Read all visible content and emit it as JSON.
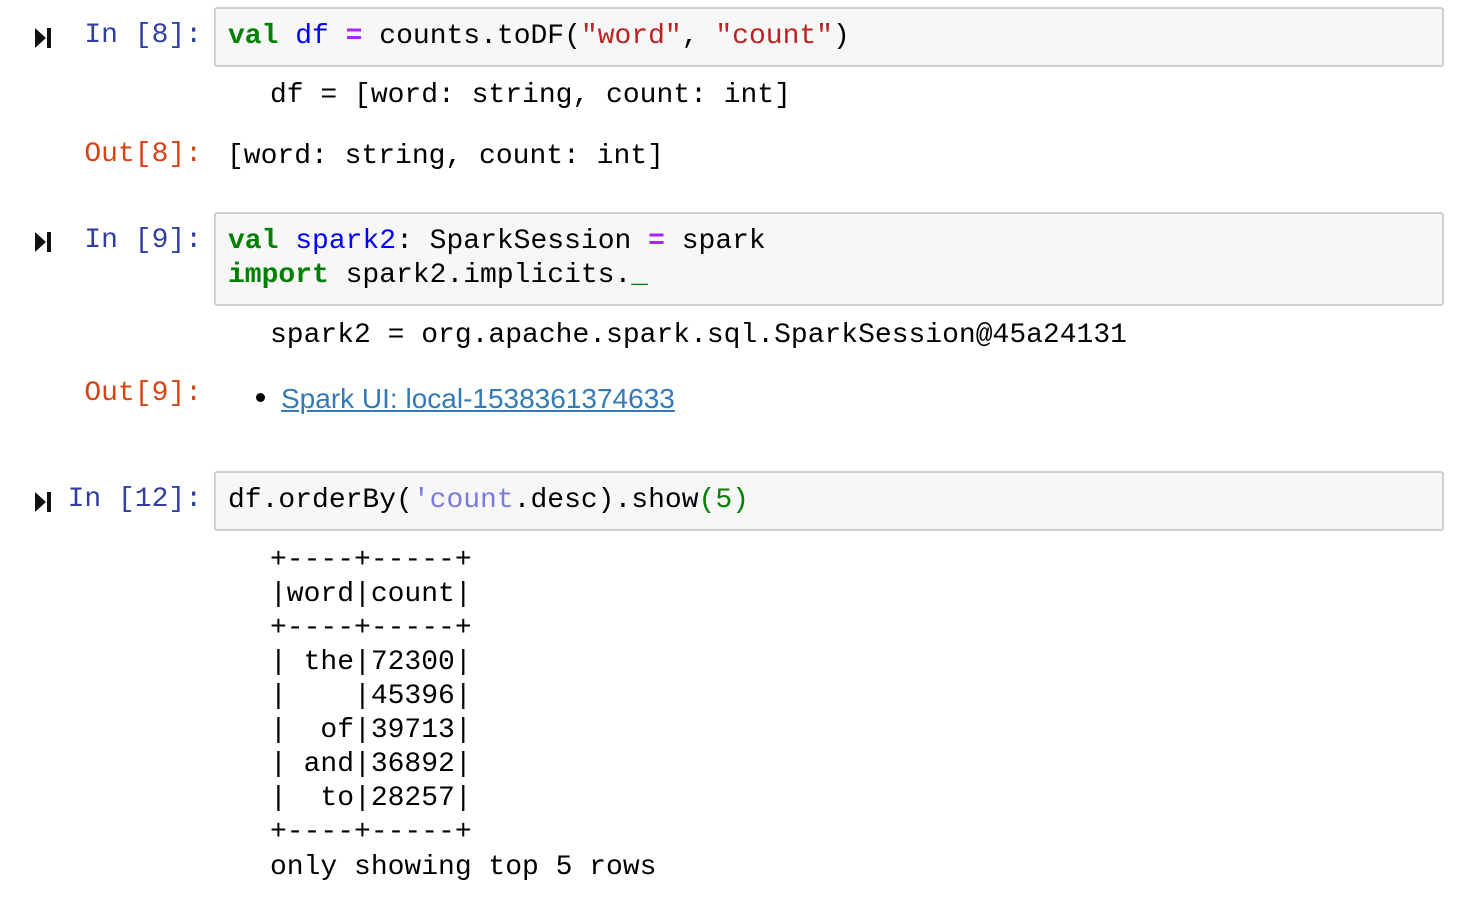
{
  "cells": [
    {
      "in_prompt": "In [8]:",
      "code_tokens": {
        "kw1": "val",
        "name": "df",
        "eq": "=",
        "expr_a": "counts.toDF(",
        "str1": "\"word\"",
        "comma": ", ",
        "str2": "\"count\"",
        "close": ")"
      },
      "stdout": "df = [word: string, count: int]",
      "out_prompt": "Out[8]:",
      "out_text": "[word: string, count: int]"
    },
    {
      "in_prompt": "In [9]:",
      "code_tokens": {
        "kw1": "val",
        "name": "spark2",
        "type_part": ": SparkSession ",
        "eq": "=",
        "rhs": " spark",
        "kw2": "import",
        "import_path": " spark2.implicits.",
        "underscore": "_"
      },
      "stdout": "spark2 = org.apache.spark.sql.SparkSession@45a24131",
      "out_prompt": "Out[9]:",
      "link_text": "Spark UI: local-1538361374633"
    },
    {
      "in_prompt": "In [12]:",
      "code_tokens": {
        "expr_a": "df.orderBy(",
        "symbol": "'count",
        "expr_b": ".desc).show",
        "num": "(5)"
      },
      "stdout_lines": [
        "+----+-----+",
        "|word|count|",
        "+----+-----+",
        "| the|72300|",
        "|    |45396|",
        "|  of|39713|",
        "| and|36892|",
        "|  to|28257|",
        "+----+-----+",
        "only showing top 5 rows"
      ]
    }
  ],
  "icons": {
    "run": "step-forward-icon"
  }
}
